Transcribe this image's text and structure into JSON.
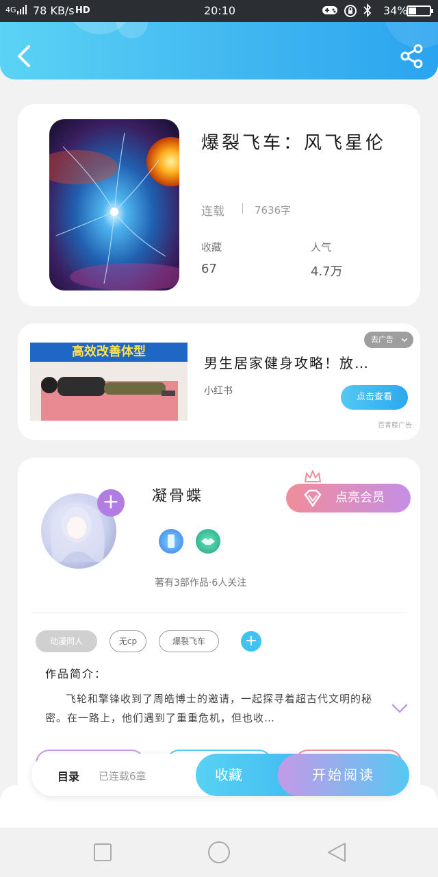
{
  "status_bar": {
    "network": "4G",
    "speed": "78 KB/s",
    "hd": "HD",
    "time": "20:10",
    "battery": "34%"
  },
  "header": {
    "back_icon": "chevron-left-icon",
    "share_icon": "share-icon",
    "color": "#41b7f0"
  },
  "book": {
    "title": "爆裂飞车：风飞星伦",
    "status": "连载",
    "word_count": "7636字",
    "stats": [
      {
        "label": "收藏",
        "value": "67"
      },
      {
        "label": "人气",
        "value": "4.7万"
      }
    ]
  },
  "ad": {
    "banner_text": "高效改善体型",
    "close_label": "去广告",
    "title": "男生居家健身攻略！放…",
    "source": "小红书",
    "cta": "点击查看",
    "provider": "百青藤广告"
  },
  "author": {
    "name": "凝骨蝶",
    "vip_label": "点亮会员",
    "meta": "著有3部作品·6人关注",
    "badges": [
      "phone-badge-icon",
      "handshake-badge-icon"
    ]
  },
  "tags": [
    "动漫同人",
    "无cp",
    "爆裂飞车"
  ],
  "intro": {
    "label": "作品简介：",
    "text": "飞轮和擎锋收到了周皓博士的邀请，一起探寻着超古代文明的秘密。在一路上，他们遇到了重重危机，但也收…"
  },
  "bottom_bar": {
    "catalog_label": "目录",
    "chapters": "已连载6章",
    "collect_label": "收藏",
    "read_label": "开始阅读"
  },
  "nav": {
    "recent_icon": "square-icon",
    "home_icon": "circle-icon",
    "back_icon": "triangle-back-icon"
  }
}
